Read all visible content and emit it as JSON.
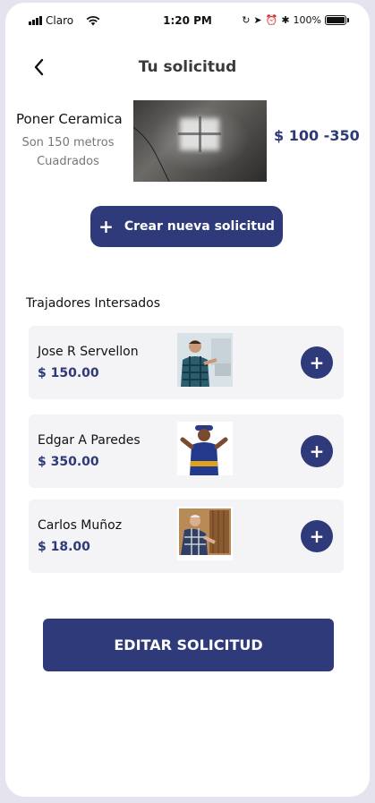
{
  "status_bar": {
    "carrier": "Claro",
    "time": "1:20 PM",
    "battery": "100%"
  },
  "header": {
    "title": "Tu solicitud",
    "back_icon": "chevron-left-icon"
  },
  "request": {
    "name": "Poner Ceramica",
    "description": "Son 150 metros Cuadrados",
    "price_range": "$ 100 -350"
  },
  "create_button": {
    "icon": "plus-icon",
    "label": "Crear nueva solicitud"
  },
  "workers_section": {
    "title": "Trajadores Intersados",
    "workers": [
      {
        "name": "Jose R Servellon",
        "price": "$ 150.00"
      },
      {
        "name": "Edgar A Paredes",
        "price": " $ 350.00"
      },
      {
        "name": "Carlos Muñoz",
        "price": "$ 18.00"
      }
    ]
  },
  "edit_button": {
    "label": "EDITAR SOLICITUD"
  },
  "colors": {
    "primary": "#2f3a7a",
    "accent_text": "#2e3a78",
    "card_bg": "#f4f4f7",
    "page_bg": "#e4e3ee"
  }
}
